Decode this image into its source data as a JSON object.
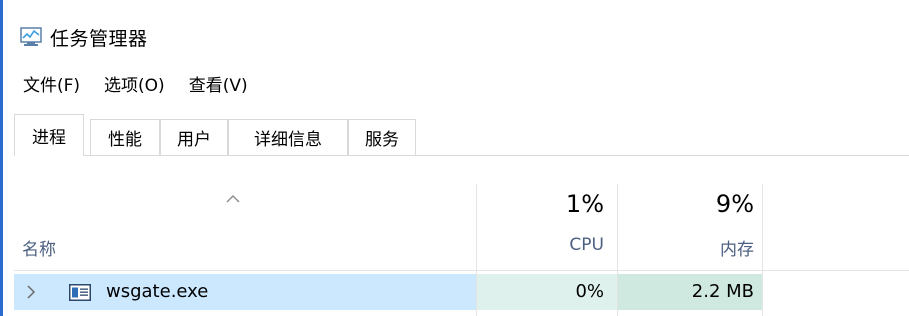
{
  "app": {
    "title": "任务管理器",
    "icon": "task-manager-icon"
  },
  "menu": {
    "items": [
      "文件(F)",
      "选项(O)",
      "查看(V)"
    ]
  },
  "tabs": [
    {
      "label": "进程",
      "active": true
    },
    {
      "label": "性能",
      "active": false
    },
    {
      "label": "用户",
      "active": false
    },
    {
      "label": "详细信息",
      "active": false
    },
    {
      "label": "服务",
      "active": false
    }
  ],
  "columns": {
    "name": {
      "label": "名称",
      "sort_icon": "sort-up-icon"
    },
    "cpu": {
      "label": "CPU",
      "total": "1%"
    },
    "memory": {
      "label": "内存",
      "total": "9%"
    }
  },
  "rows": [
    {
      "name": "wsgate.exe",
      "cpu": "0%",
      "memory": "2.2 MB",
      "icon": "window-app-icon",
      "expand_icon": "chevron-right-icon",
      "selected": true
    }
  ],
  "colors": {
    "accent_border": "#2a6bd1",
    "selected_row": "#cce8ff",
    "cpu_heat": "#dff1ec",
    "memory_heat": "#cfe9e0",
    "column_label": "#4d6082"
  }
}
